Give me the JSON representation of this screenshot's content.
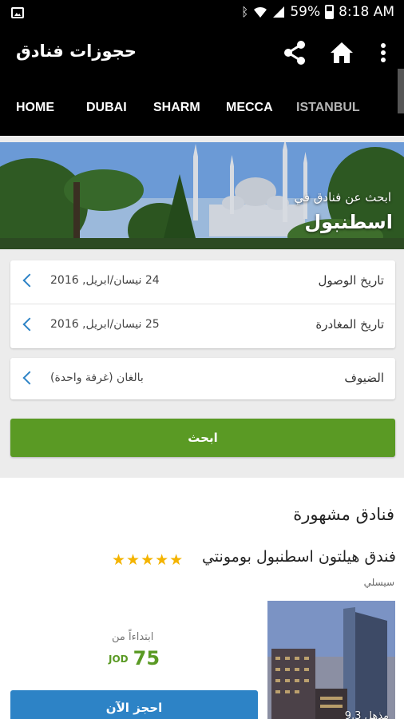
{
  "status_bar": {
    "battery": "59%",
    "time": "8:18 AM"
  },
  "app_bar": {
    "title": "حجوزات فنادق"
  },
  "tabs": [
    "HOME",
    "DUBAI",
    "SHARM",
    "MECCA",
    "ISTANBUL"
  ],
  "hero": {
    "subtitle": "ابحث عن فنادق في",
    "city": "اسطنبول"
  },
  "search_form": {
    "arrival": {
      "label": "تاريخ الوصول",
      "value": "24 نيسان/ابريل, 2016"
    },
    "departure": {
      "label": "تاريخ المغادرة",
      "value": "25 نيسان/ابريل, 2016"
    },
    "guests": {
      "label": "الضيوف",
      "value": "بالغان (غرفة واحدة)"
    },
    "search_label": "ابحث"
  },
  "popular": {
    "title": "فنادق مشهورة",
    "hotel": {
      "name": "فندق هيلتون اسطنبول بومونتي",
      "stars": 5,
      "stars_text": "★★★★★",
      "area": "سيسلي",
      "photo_badge": "مذهل 9,3",
      "price_from": "ابتداءاً من",
      "price": "75",
      "currency": "JOD",
      "book_label": "احجز الآن"
    }
  },
  "colors": {
    "accent_green": "#5a9a24",
    "accent_blue": "#2d83c6",
    "star": "#f4b400"
  }
}
